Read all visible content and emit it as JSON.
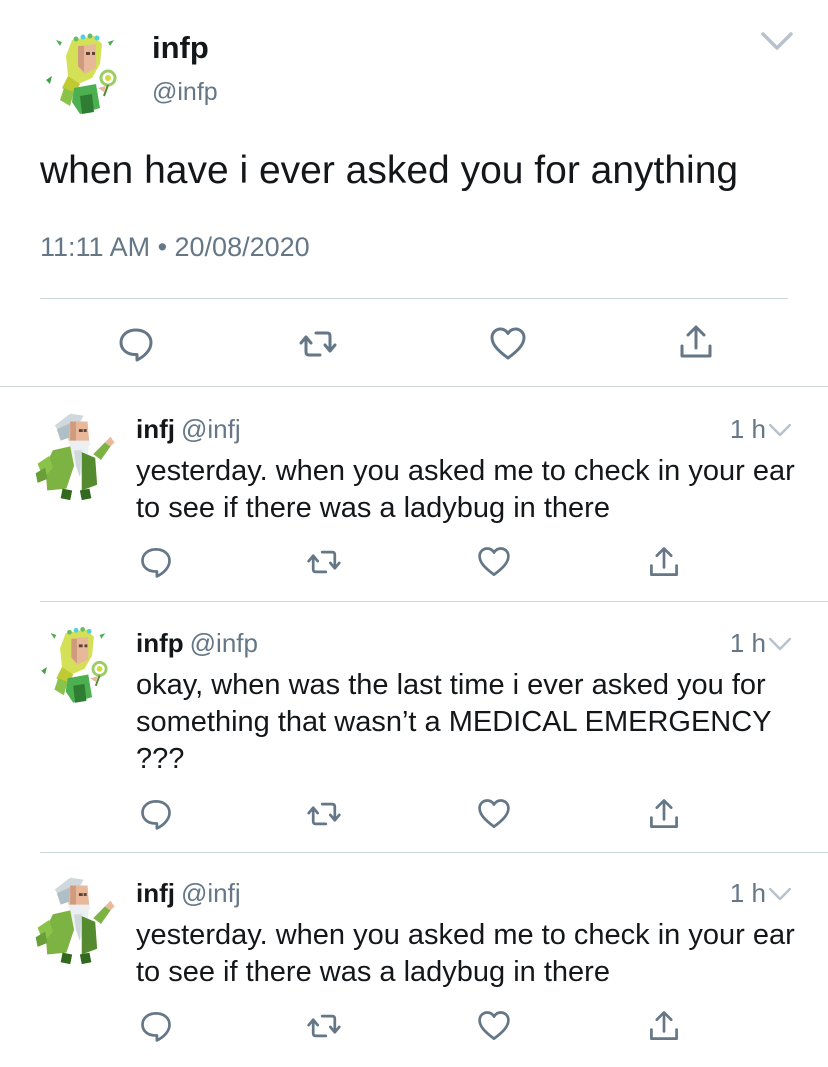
{
  "main_tweet": {
    "display_name": "infp",
    "handle": "@infp",
    "text": "when have i ever asked you for anything",
    "timestamp": "11:11 AM • 20/08/2020",
    "avatar": "infp-avatar",
    "menu_icon": "chevron-down-icon",
    "actions": [
      "reply-icon",
      "retweet-icon",
      "like-icon",
      "share-icon"
    ]
  },
  "replies": [
    {
      "display_name": "infj",
      "handle": "@infj",
      "time": "1 h",
      "text": "yesterday. when you asked me to check in your ear to see if there was a ladybug in there",
      "avatar": "infj-avatar"
    },
    {
      "display_name": "infp",
      "handle": "@infp",
      "time": "1 h",
      "text": "okay, when was the last time i ever asked you for something that wasn’t a MEDICAL EMERGENCY ???",
      "avatar": "infp-avatar"
    },
    {
      "display_name": "infj",
      "handle": "@infj",
      "time": "1 h",
      "text": "yesterday. when you asked me to check in your ear to see if there was a ladybug in there",
      "avatar": "infj-avatar"
    }
  ],
  "colors": {
    "text": "#14171a",
    "secondary": "#657786",
    "divider": "#ccd6dd",
    "icon": "#657786"
  }
}
